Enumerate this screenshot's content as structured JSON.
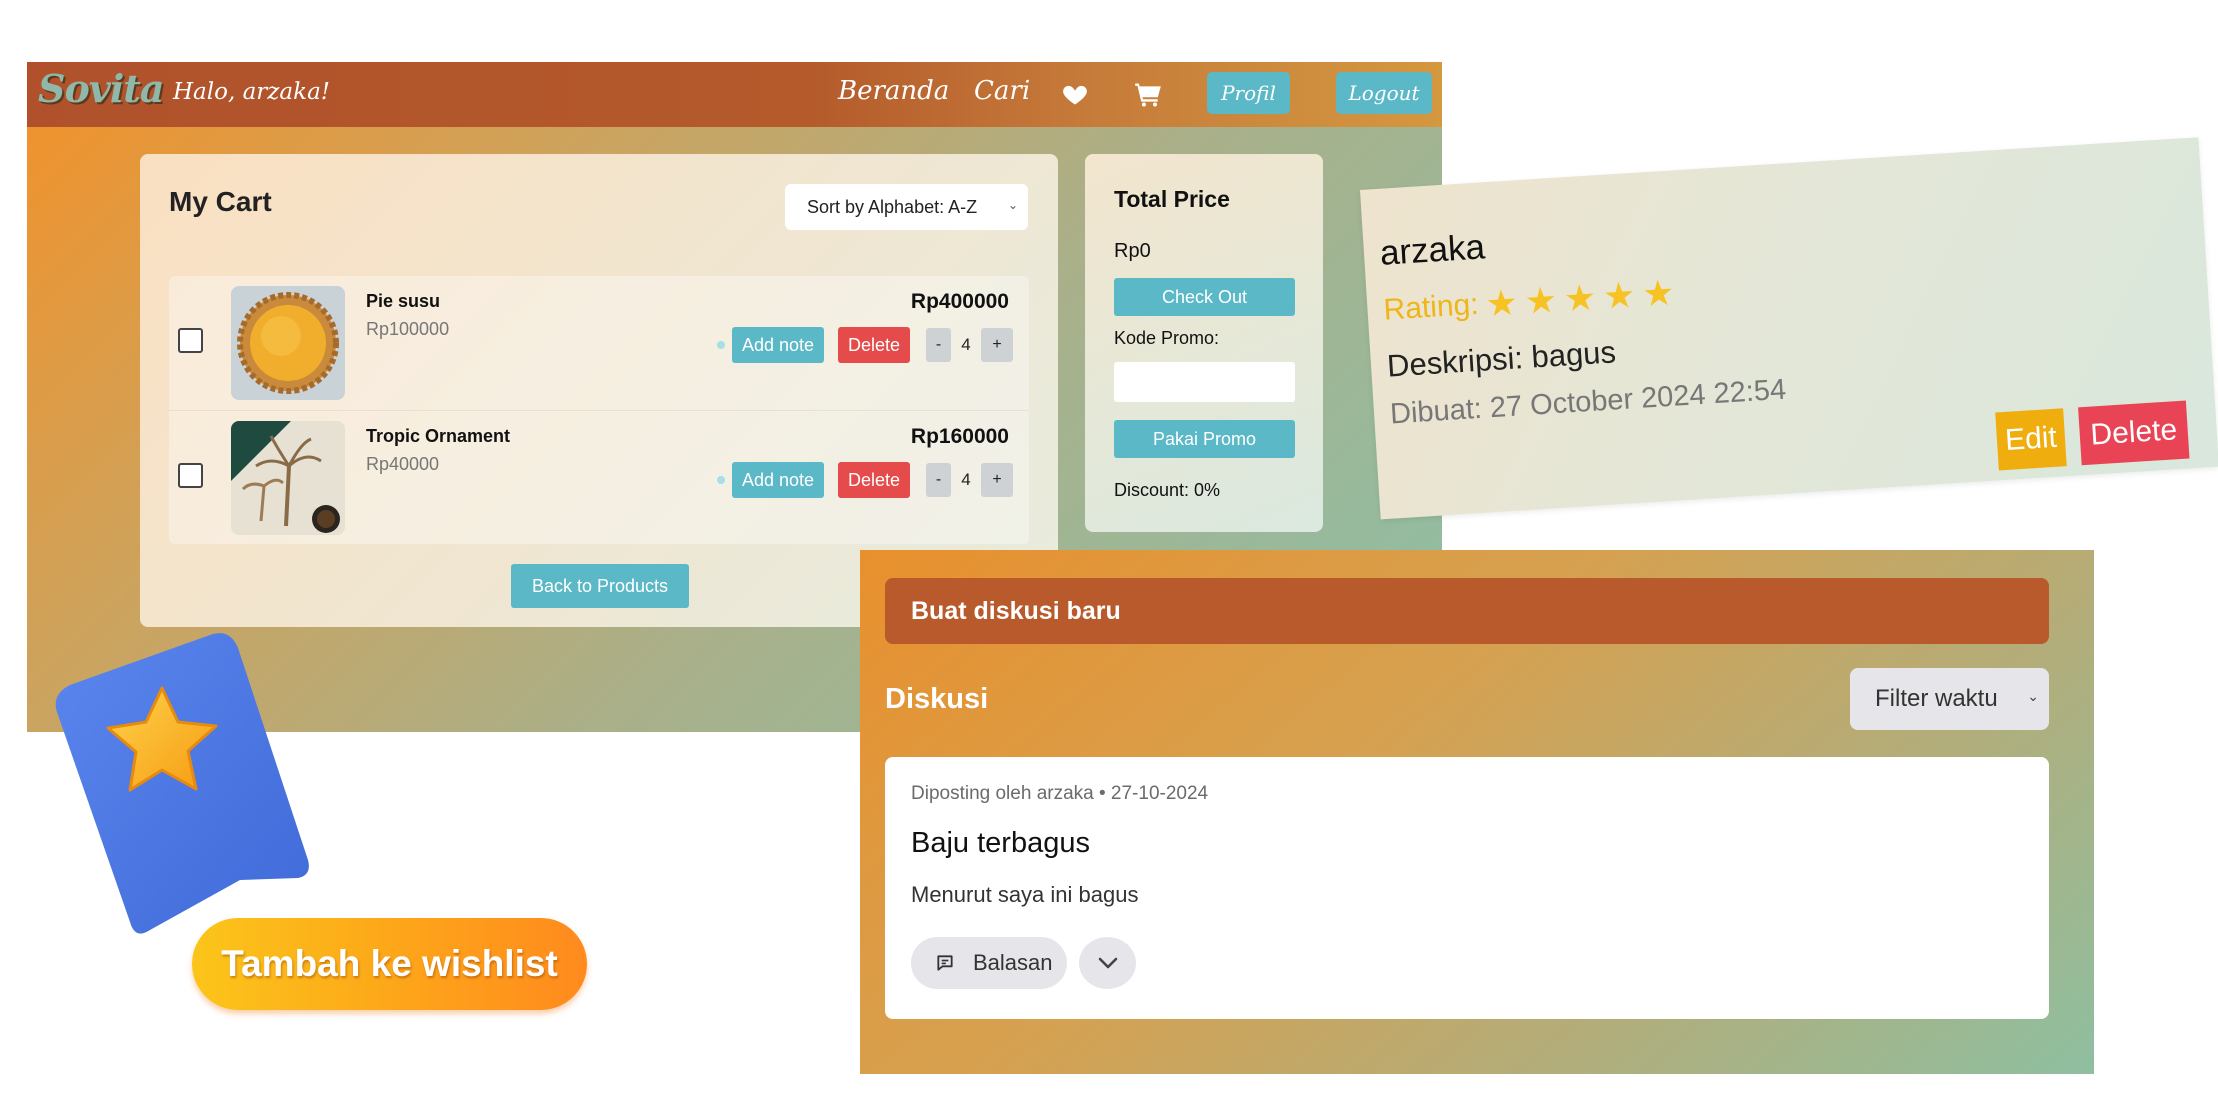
{
  "navbar": {
    "logo": "Sovita",
    "greeting": "Halo, arzaka!",
    "links": [
      "Beranda",
      "Cari"
    ],
    "profile_label": "Profil",
    "logout_label": "Logout",
    "icons": [
      "heart-icon",
      "cart-icon"
    ]
  },
  "cart": {
    "title": "My Cart",
    "sort_value": "Sort by Alphabet: A-Z",
    "items": [
      {
        "name": "Pie susu",
        "unit_price": "Rp100000",
        "total": "Rp400000",
        "qty": "4",
        "checked": false
      },
      {
        "name": "Tropic Ornament",
        "unit_price": "Rp40000",
        "total": "Rp160000",
        "qty": "4",
        "checked": false
      }
    ],
    "add_note_label": "Add note",
    "delete_label": "Delete",
    "minus_label": "-",
    "plus_label": "+",
    "back_label": "Back to Products"
  },
  "price": {
    "title": "Total Price",
    "total": "Rp0",
    "checkout_label": "Check Out",
    "promo_label": "Kode Promo:",
    "promo_value": "",
    "apply_promo_label": "Pakai Promo",
    "discount": "Discount: 0%"
  },
  "review": {
    "name": "arzaka",
    "rating_label": "Rating:",
    "rating": 5,
    "description": "Deskripsi: bagus",
    "created": "Dibuat: 27 October 2024 22:54",
    "edit_label": "Edit",
    "delete_label": "Delete"
  },
  "discussion": {
    "new_label": "Buat diskusi baru",
    "title": "Diskusi",
    "filter_value": "Filter waktu",
    "post": {
      "meta": "Diposting oleh arzaka • 27-10-2024",
      "title": "Baju terbagus",
      "body": "Menurut saya ini bagus",
      "reply_label": "Balasan"
    }
  },
  "wishlist": {
    "label": "Tambah ke wishlist"
  },
  "colors": {
    "accent": "#5bb8c7",
    "danger": "#e54b4b",
    "navbar": "#b0512b",
    "star": "#f7c324",
    "edit": "#f0ad0e"
  }
}
